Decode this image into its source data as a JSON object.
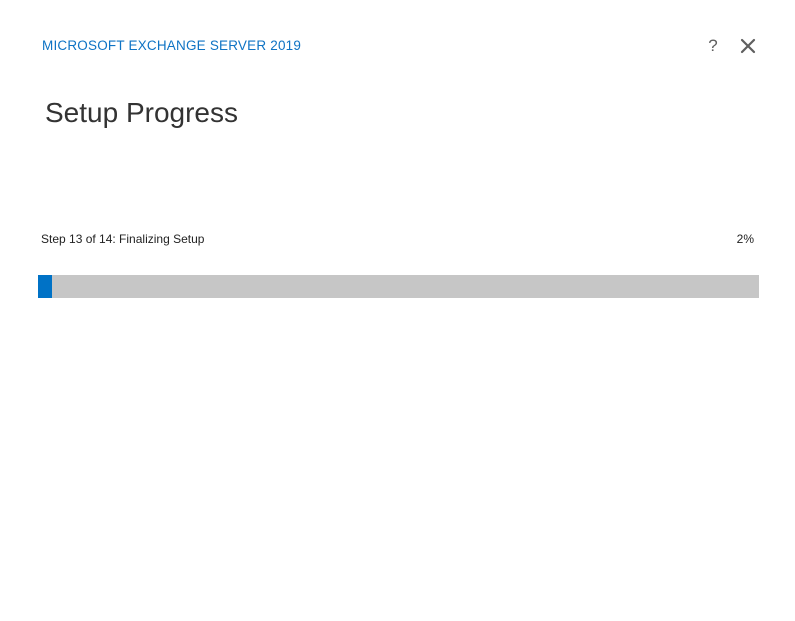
{
  "window": {
    "app_title": "MICROSOFT EXCHANGE SERVER 2019",
    "help_label": "?",
    "close_icon": "close-icon"
  },
  "main": {
    "page_title": "Setup Progress",
    "step_text": "Step 13 of 14: Finalizing Setup",
    "percent_text": "2%",
    "progress_fraction": 0.02
  },
  "colors": {
    "accent": "#0072c6",
    "title_text": "#0e73c4",
    "track": "#c6c6c6"
  }
}
